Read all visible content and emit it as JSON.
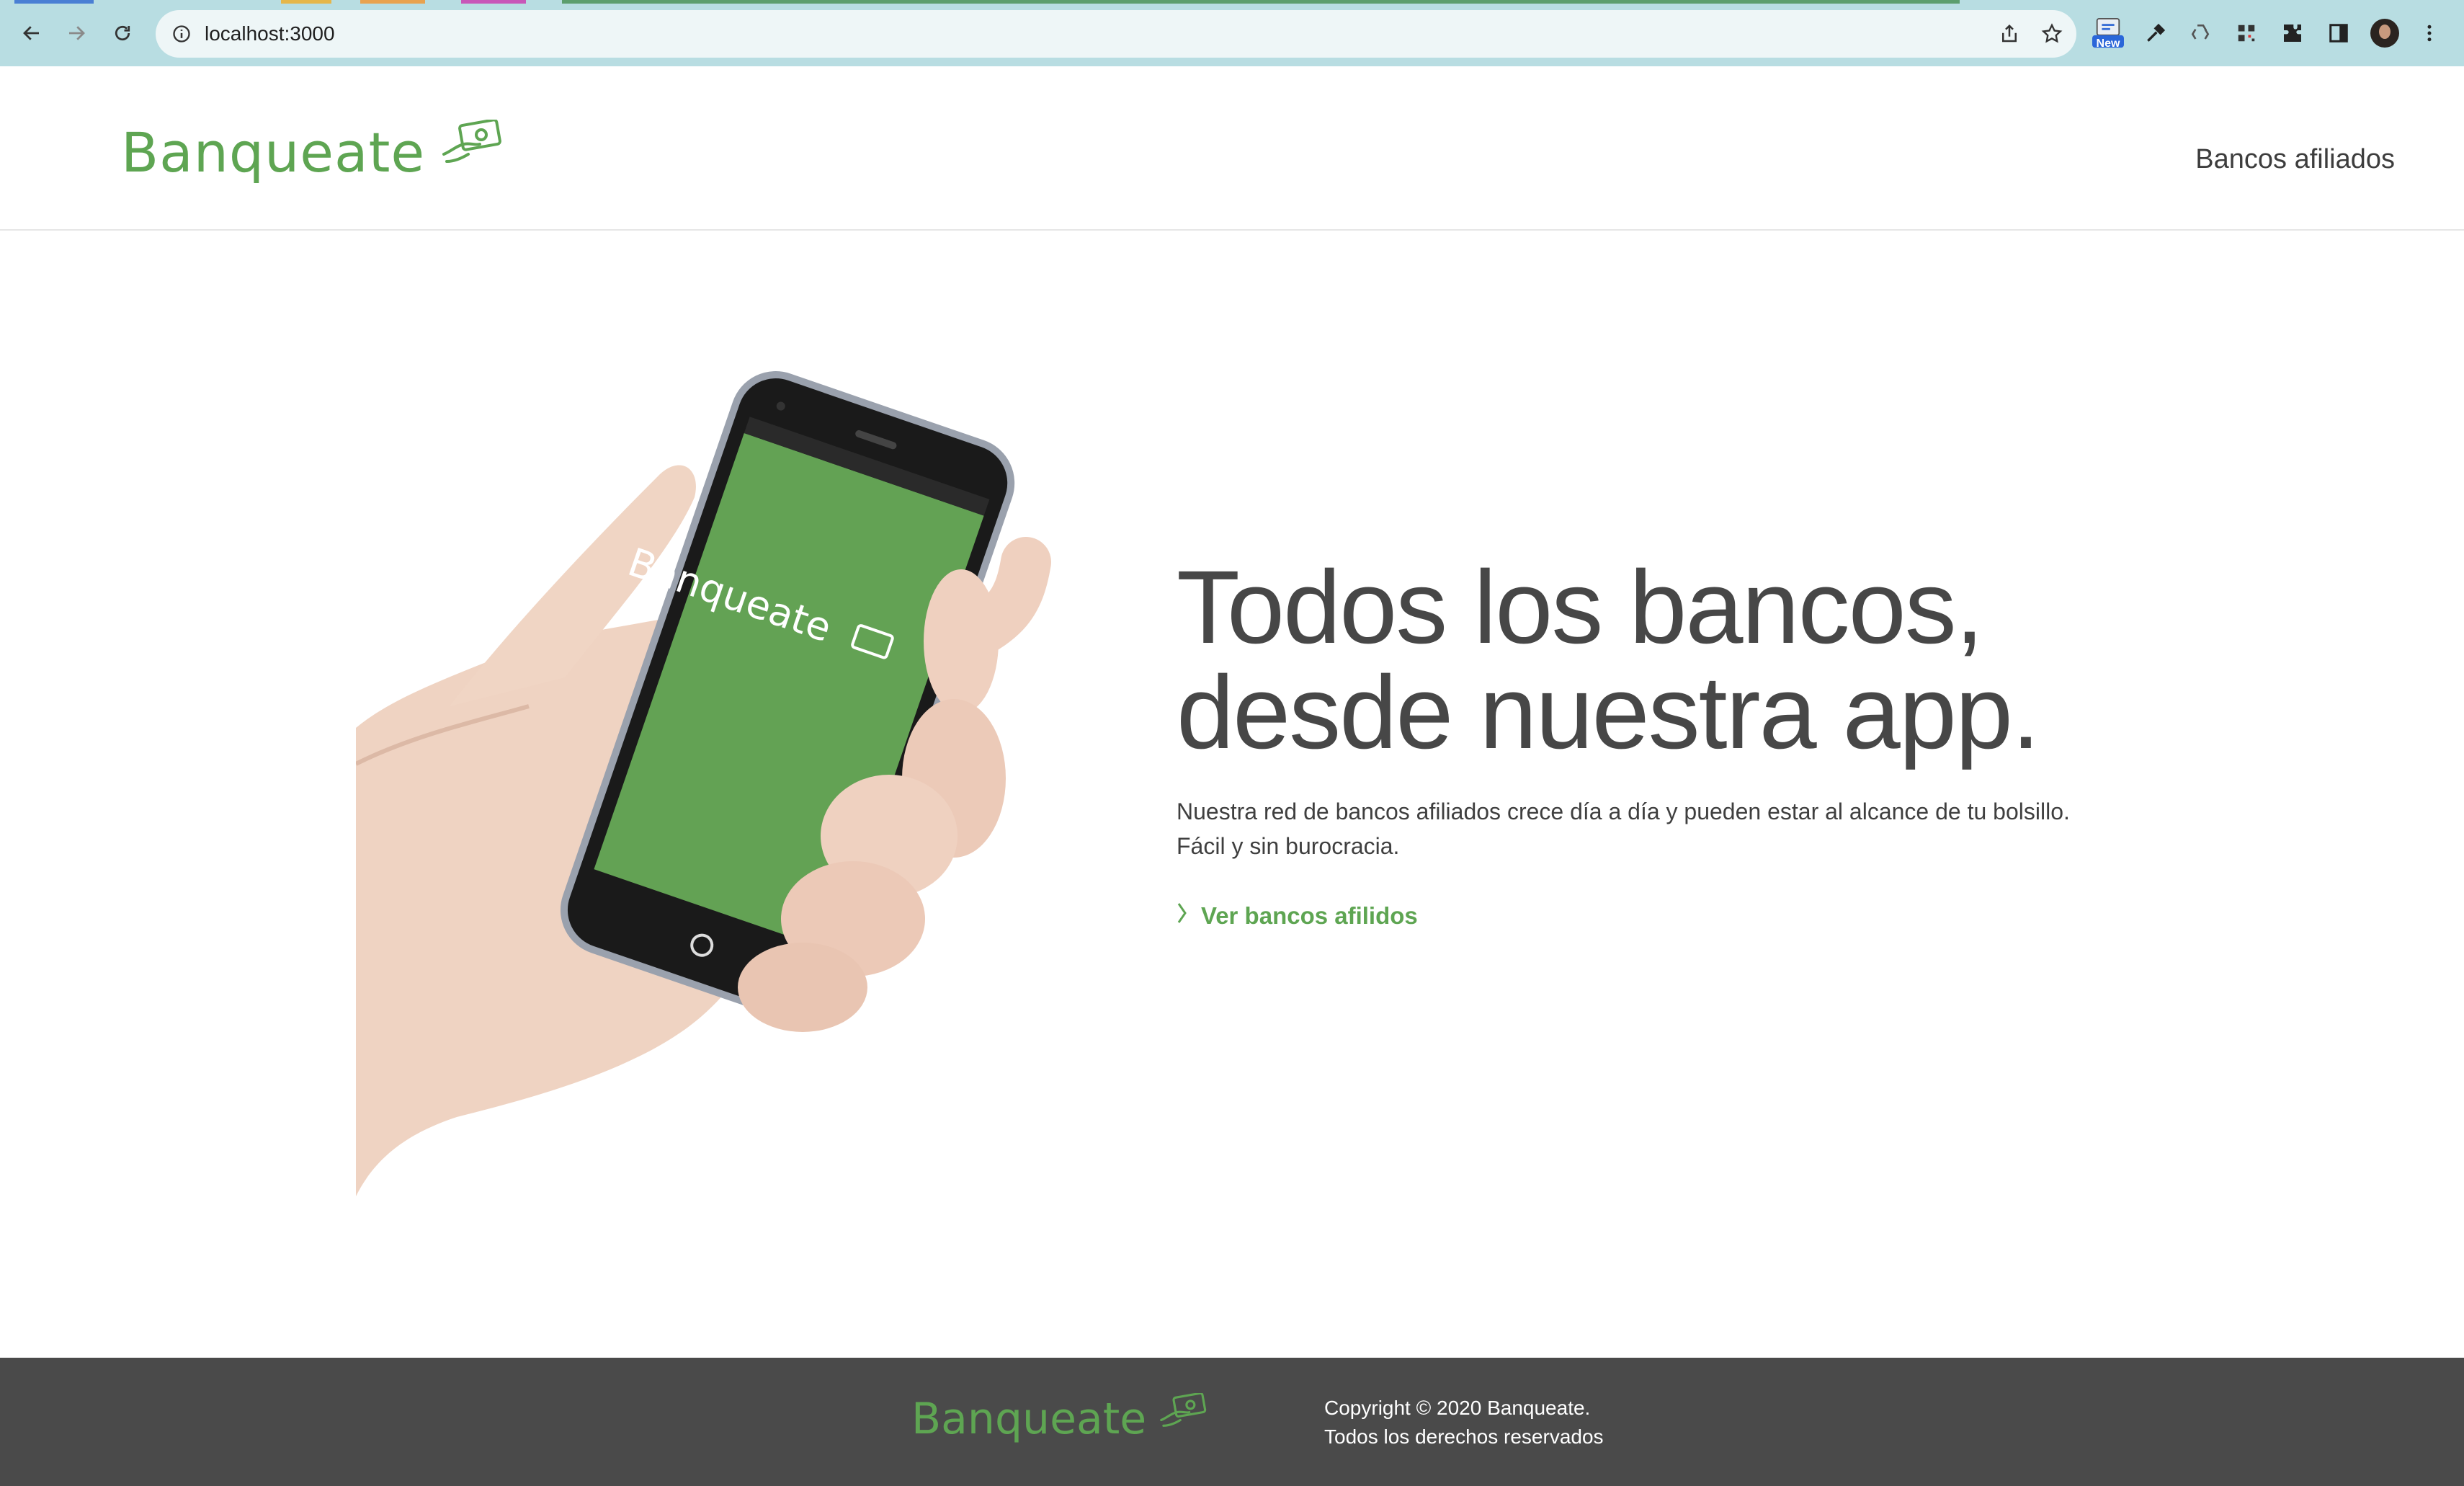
{
  "browser": {
    "url": "localhost:3000",
    "extension_badge": "New",
    "icons": [
      "back-arrow-icon",
      "forward-arrow-icon",
      "reload-icon",
      "info-icon",
      "share-icon",
      "star-icon",
      "extension-new-icon",
      "eyedropper-icon",
      "recycle-icon",
      "qr-code-icon",
      "puzzle-icon",
      "sidebar-icon",
      "profile-avatar",
      "kebab-menu-icon"
    ]
  },
  "header": {
    "brand": "Banqueate",
    "nav_link": "Bancos afiliados"
  },
  "hero": {
    "title_line1": "Todos los bancos,",
    "title_line2": "desde nuestra app.",
    "desc_line1": "Nuestra red de bancos afiliados crece día a día y pueden estar al alcance de tu bolsillo.",
    "desc_line2": "Fácil y sin burocracia.",
    "cta_label": "Ver bancos afilidos",
    "phone_screen_brand": "Banqueate"
  },
  "footer": {
    "brand": "Banqueate",
    "copyright": "Copyright © 2020 Banqueate.",
    "rights": "Todos los derechos reservados"
  },
  "colors": {
    "brand_green": "#5ea552",
    "phone_screen": "#63a254",
    "chrome_bg": "#b8dde2",
    "footer_bg": "#4a4a4a",
    "text_dark": "#474747"
  }
}
